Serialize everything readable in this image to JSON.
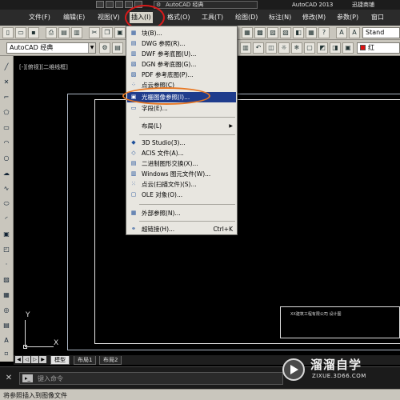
{
  "titlebar": {
    "workspace": "AutoCAD 经典",
    "app_title": "AutoCAD 2013",
    "user": "迅捷商铺"
  },
  "menubar": {
    "items": [
      "文件(F)",
      "编辑(E)",
      "视图(V)",
      "插入(I)",
      "格式(O)",
      "工具(T)",
      "绘图(D)",
      "标注(N)",
      "修改(M)",
      "参数(P)",
      "窗口"
    ]
  },
  "toolbar2": {
    "workspace_combo": "AutoCAD 经典",
    "color_value": "红"
  },
  "toolbar1": {
    "style_combo": "Stand"
  },
  "viewport": {
    "label": "[-][俯视][二维线框]"
  },
  "insert_menu": {
    "items": [
      {
        "label": "块(B)...",
        "icon": "block-icon"
      },
      {
        "label": "DWG 参照(R)...",
        "icon": "dwg-icon"
      },
      {
        "label": "DWF 参考底图(U)...",
        "icon": "dwf-icon"
      },
      {
        "label": "DGN 参考底图(G)...",
        "icon": "dgn-icon"
      },
      {
        "label": "PDF 参考底图(P)...",
        "icon": "pdf-icon"
      },
      {
        "label": "点云参照(C)",
        "icon": "pointcloud-icon"
      },
      {
        "label": "光栅图像参照(I)...",
        "icon": "raster-icon"
      },
      {
        "label": "字段(E)...",
        "icon": "field-icon"
      },
      {
        "label": "布局(L)"
      },
      {
        "label": "3D Studio(3)...",
        "icon": "3ds-icon"
      },
      {
        "label": "ACIS 文件(A)...",
        "icon": "acis-icon"
      },
      {
        "label": "二进制图形交换(X)...",
        "icon": "dxb-icon"
      },
      {
        "label": "Windows 图元文件(W)...",
        "icon": "wmf-icon"
      },
      {
        "label": "点云(扫描文件)(S)...",
        "icon": "scan-icon"
      },
      {
        "label": "OLE 对象(O)...",
        "icon": "ole-icon"
      },
      {
        "label": "外部参照(N)...",
        "icon": "xref-icon"
      },
      {
        "label": "超链接(H)...",
        "icon": "hyperlink-icon",
        "shortcut": "Ctrl+K"
      }
    ]
  },
  "layout_tabs": [
    "模型",
    "布局1",
    "布局2"
  ],
  "command_line": {
    "placeholder": "键入命令"
  },
  "status": {
    "text": "将参照插入到图像文件"
  },
  "title_block": {
    "text": "XX建筑工程有限公司 设计图"
  },
  "ucs": {
    "x": "X",
    "y": "Y"
  },
  "watermark": {
    "name": "溜溜自学",
    "url": "ZIXUE.3D66.COM"
  },
  "colors": {
    "menu_highlight": "#1f3c8c",
    "ring_red": "#d71a1a",
    "ring_orange": "#e87722"
  }
}
